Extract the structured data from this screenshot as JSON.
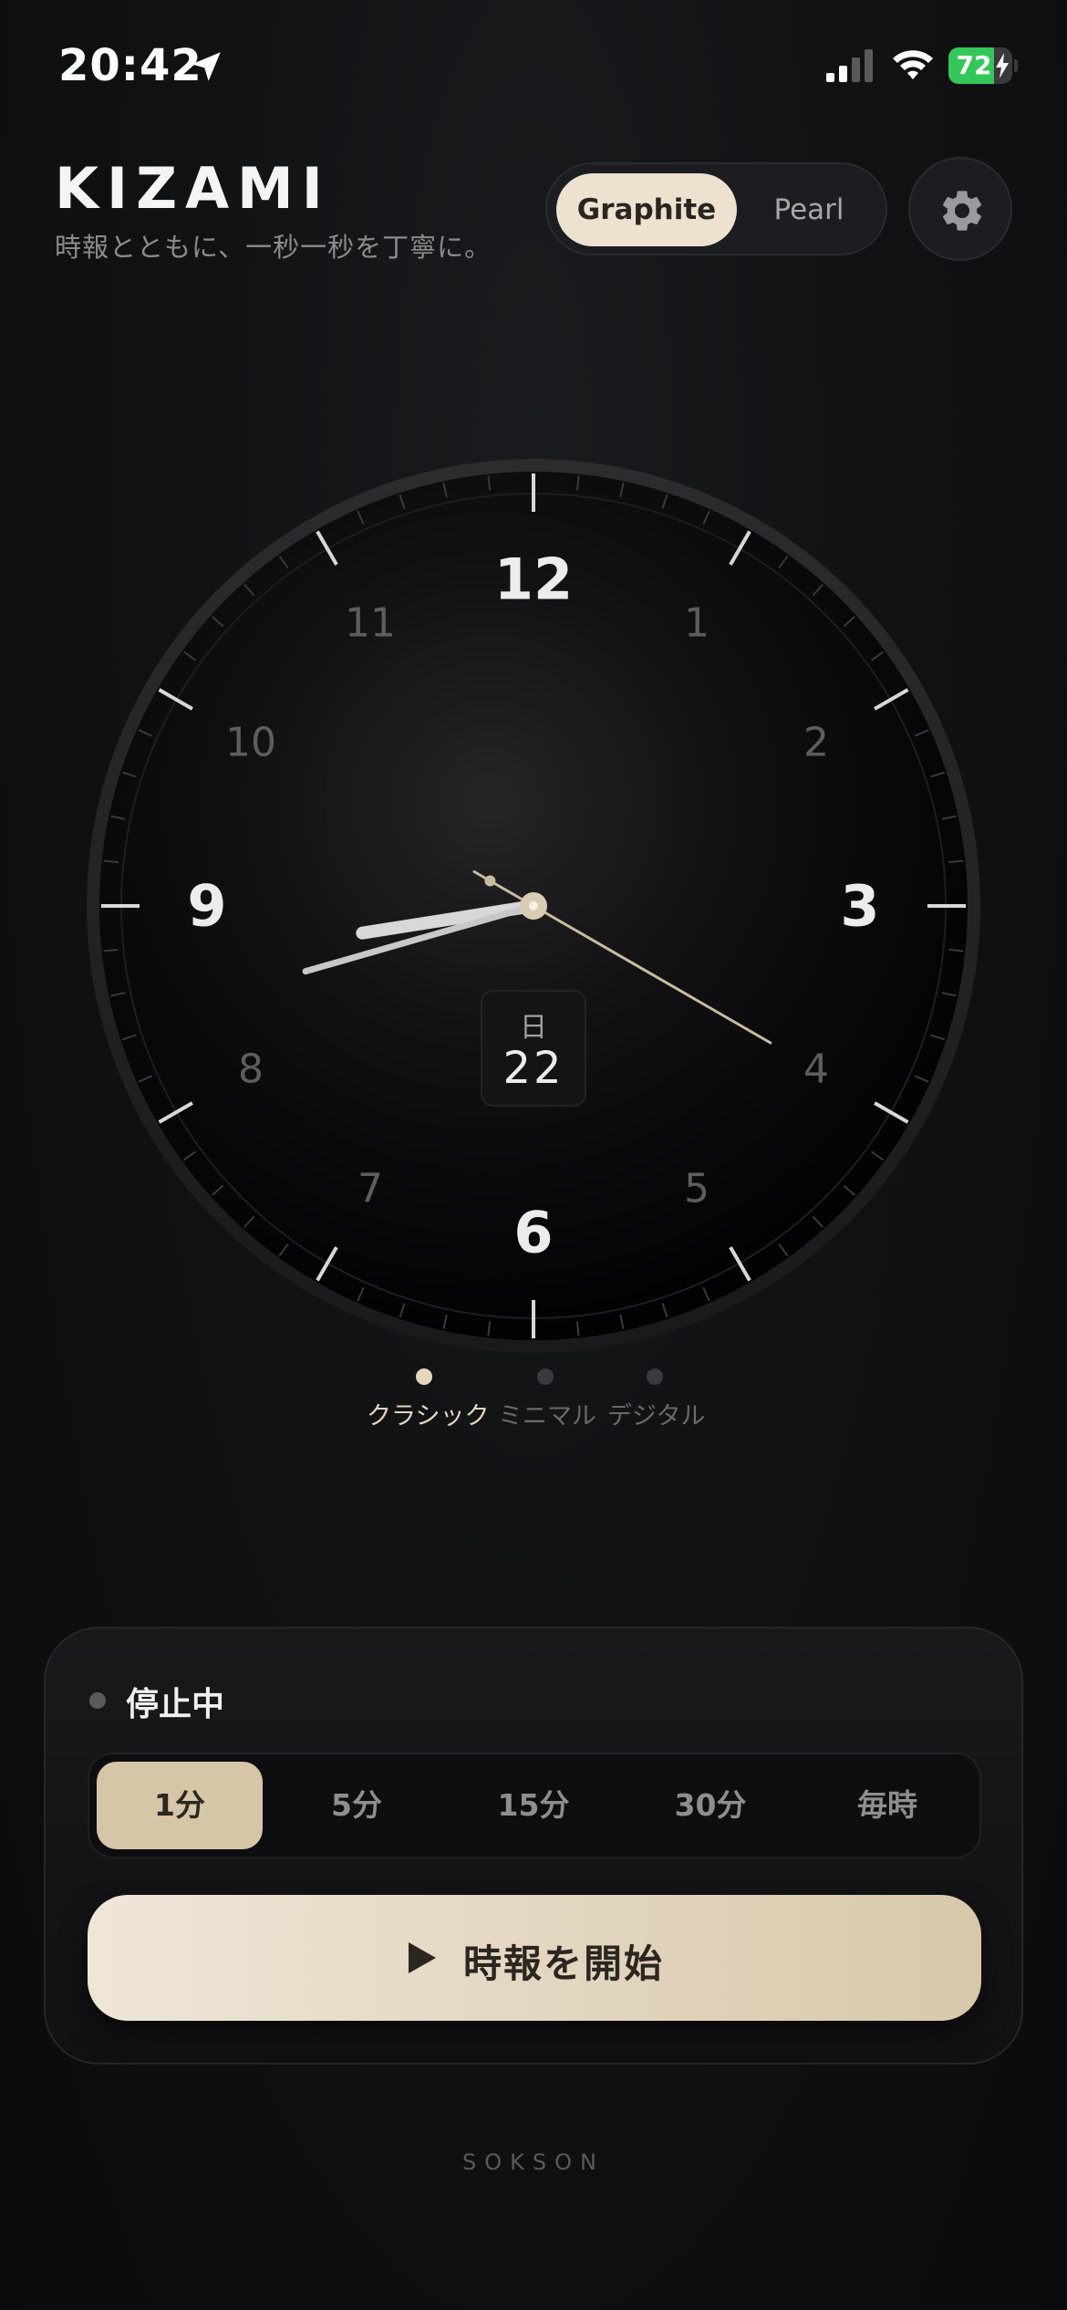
{
  "status_bar": {
    "time": "20:42",
    "battery_percent": "72",
    "battery_level": 0.72
  },
  "header": {
    "title": "KIZAMI",
    "subtitle": "時報とともに、一秒一秒を丁寧に。",
    "theme_options": [
      "Graphite",
      "Pearl"
    ],
    "selected_theme": "Graphite"
  },
  "clock": {
    "numerals": [
      "12",
      "1",
      "2",
      "3",
      "4",
      "5",
      "6",
      "7",
      "8",
      "9",
      "10",
      "11"
    ],
    "time": {
      "hours": 20,
      "minutes": 42,
      "seconds": 20
    },
    "date_weekday": "日",
    "date_day": "22"
  },
  "faces": {
    "options": [
      "クラシック",
      "ミニマル",
      "デジタル"
    ],
    "selected": "クラシック"
  },
  "panel": {
    "status_label": "停止中",
    "intervals": [
      "1分",
      "5分",
      "15分",
      "30分",
      "毎時"
    ],
    "selected_interval": "1分",
    "start_label": "時報を開始"
  },
  "footer": {
    "brand": "SOKSON"
  },
  "colors": {
    "accent": "#e6d6bd",
    "background": "#111214",
    "button_start": "#efe6d8",
    "button_end": "#d8c8aa",
    "battery": "#33c759"
  }
}
